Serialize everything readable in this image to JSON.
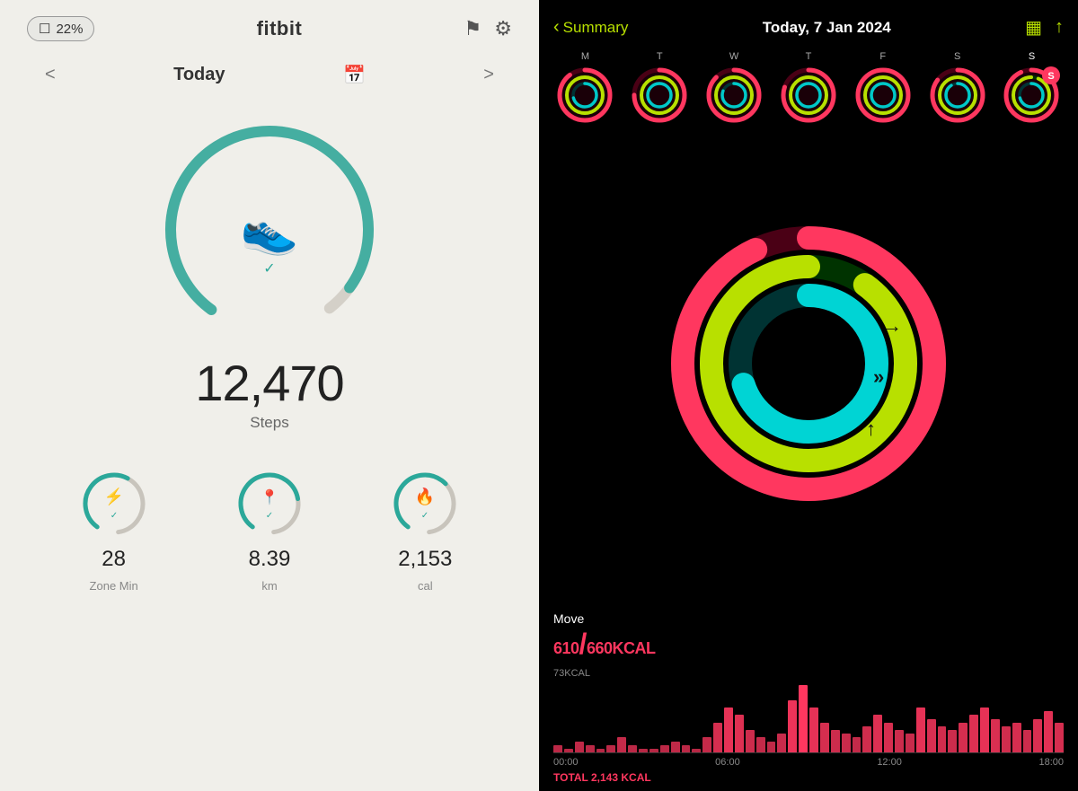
{
  "fitbit": {
    "battery_percent": "22%",
    "logo": "fitbit",
    "header_icons": [
      "flag-icon",
      "gear-icon"
    ],
    "nav": {
      "prev_label": "<",
      "title": "Today",
      "next_label": ">"
    },
    "steps": {
      "value": "12,470",
      "label": "Steps",
      "ring_progress": 0.92
    },
    "stats": [
      {
        "value": "28",
        "label": "Zone Min",
        "icon": "⚡",
        "progress": 0.6
      },
      {
        "value": "8.39",
        "label": "km",
        "icon": "📍",
        "progress": 0.75
      },
      {
        "value": "2,153",
        "label": "cal",
        "icon": "🔥",
        "progress": 0.65
      }
    ]
  },
  "activity": {
    "back_label": "Summary",
    "date": "Today, 7 Jan 2024",
    "week_days": [
      {
        "label": "M",
        "active": false
      },
      {
        "label": "T",
        "active": false
      },
      {
        "label": "W",
        "active": false
      },
      {
        "label": "T",
        "active": false
      },
      {
        "label": "F",
        "active": false
      },
      {
        "label": "S",
        "active": false
      },
      {
        "label": "S",
        "active": true,
        "is_today": true
      }
    ],
    "rings": {
      "move": {
        "color": "#ff375f",
        "progress": 0.93,
        "label": "Move"
      },
      "exercise": {
        "color": "#b8e000",
        "progress": 1.1
      },
      "stand": {
        "color": "#00d4d4",
        "progress": 0.7
      }
    },
    "move_current": "610",
    "move_goal": "660",
    "move_unit": "KCAL",
    "chart": {
      "y_label": "73KCAL",
      "x_labels": [
        "00:00",
        "06:00",
        "12:00",
        "18:00"
      ],
      "total_label": "TOTAL 2,143 KCAL",
      "bars": [
        2,
        1,
        3,
        2,
        1,
        2,
        4,
        2,
        1,
        1,
        2,
        3,
        2,
        1,
        4,
        8,
        12,
        10,
        6,
        4,
        3,
        5,
        14,
        18,
        12,
        8,
        6,
        5,
        4,
        7,
        10,
        8,
        6,
        5,
        12,
        9,
        7,
        6,
        8,
        10,
        12,
        9,
        7,
        8,
        6,
        9,
        11,
        8
      ]
    }
  }
}
